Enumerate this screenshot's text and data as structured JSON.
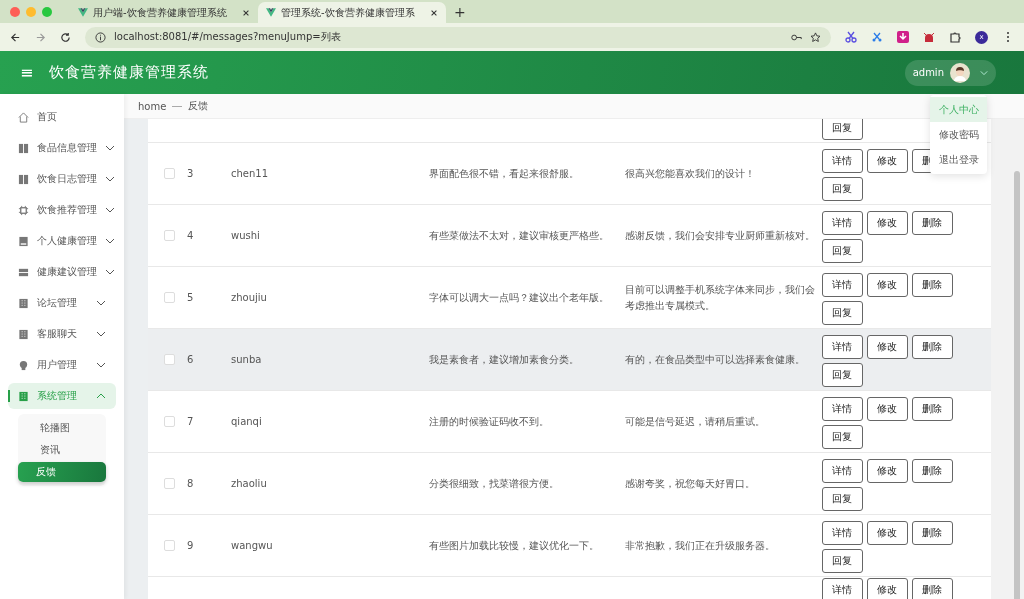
{
  "browser": {
    "tabs": [
      {
        "title": "用户端-饮食营养健康管理系统",
        "selected": false
      },
      {
        "title": "管理系统-饮食营养健康管理系",
        "selected": true
      }
    ],
    "new_tab": "+",
    "url": "localhost:8081/#/messages?menuJump=列表",
    "profile": "x"
  },
  "header": {
    "menu_glyph": "≡",
    "title": "饮食营养健康管理系统",
    "user": "admin"
  },
  "user_menu": [
    {
      "label": "个人中心",
      "selected": true
    },
    {
      "label": "修改密码",
      "selected": false
    },
    {
      "label": "退出登录",
      "selected": false
    }
  ],
  "sidebar": {
    "items": [
      {
        "label": "首页",
        "kind": "link",
        "selected": false
      },
      {
        "label": "食品信息管理",
        "kind": "group",
        "expanded": false,
        "selected": false
      },
      {
        "label": "饮食日志管理",
        "kind": "group",
        "expanded": false,
        "selected": false
      },
      {
        "label": "饮食推荐管理",
        "kind": "group",
        "expanded": false,
        "selected": false
      },
      {
        "label": "个人健康管理",
        "kind": "group",
        "expanded": false,
        "selected": false
      },
      {
        "label": "健康建议管理",
        "kind": "group",
        "expanded": false,
        "selected": false
      },
      {
        "label": "论坛管理",
        "kind": "group",
        "expanded": false,
        "selected": false
      },
      {
        "label": "客服聊天",
        "kind": "group",
        "expanded": false,
        "selected": false
      },
      {
        "label": "用户管理",
        "kind": "group",
        "expanded": false,
        "selected": false
      },
      {
        "label": "系统管理",
        "kind": "group",
        "expanded": true,
        "selected": true,
        "children": [
          {
            "label": "轮播图",
            "selected": false
          },
          {
            "label": "资讯",
            "selected": false
          },
          {
            "label": "反馈",
            "selected": true
          }
        ]
      }
    ]
  },
  "breadcrumb": [
    "home",
    "反馈"
  ],
  "table": {
    "rows": [
      {
        "kind": "partial",
        "actions": [
          "回复"
        ]
      },
      {
        "kind": "full",
        "selected": false,
        "highlighted": false,
        "index": "3",
        "user": "chen11",
        "content": "界面配色很不错，看起来很舒服。",
        "reply": "很高兴您能喜欢我们的设计！",
        "actions": [
          "详情",
          "修改",
          "删",
          "回复"
        ]
      },
      {
        "kind": "full",
        "selected": false,
        "highlighted": false,
        "index": "4",
        "user": "wushi",
        "content": "有些菜做法不太对，建议审核更严格些。",
        "reply": "感谢反馈，我们会安排专业厨师重新核对。",
        "actions": [
          "详情",
          "修改",
          "删除",
          "回复"
        ]
      },
      {
        "kind": "full",
        "selected": false,
        "highlighted": false,
        "index": "5",
        "user": "zhoujiu",
        "content": "字体可以调大一点吗？建议出个老年版。",
        "reply": "目前可以调整手机系统字体来同步，我们会考虑推出专属模式。",
        "actions": [
          "详情",
          "修改",
          "删除",
          "回复"
        ]
      },
      {
        "kind": "full",
        "selected": false,
        "highlighted": true,
        "index": "6",
        "user": "sunba",
        "content": "我是素食者，建议增加素食分类。",
        "reply": "有的，在食品类型中可以选择素食健康。",
        "actions": [
          "详情",
          "修改",
          "删除",
          "回复"
        ]
      },
      {
        "kind": "full",
        "selected": false,
        "highlighted": false,
        "index": "7",
        "user": "qianqi",
        "content": "注册的时候验证码收不到。",
        "reply": "可能是信号延迟，请稍后重试。",
        "actions": [
          "详情",
          "修改",
          "删除",
          "回复"
        ]
      },
      {
        "kind": "full",
        "selected": false,
        "highlighted": false,
        "index": "8",
        "user": "zhaoliu",
        "content": "分类很细致，找菜谱很方便。",
        "reply": "感谢夸奖，祝您每天好胃口。",
        "actions": [
          "详情",
          "修改",
          "删除",
          "回复"
        ]
      },
      {
        "kind": "full",
        "selected": false,
        "highlighted": false,
        "index": "9",
        "user": "wangwu",
        "content": "有些图片加载比较慢，建议优化一下。",
        "reply": "非常抱歉，我们正在升级服务器。",
        "actions": [
          "详情",
          "修改",
          "删除",
          "回复"
        ]
      },
      {
        "kind": "partial",
        "actions": [
          "详情",
          "修改",
          "删除"
        ]
      }
    ]
  }
}
